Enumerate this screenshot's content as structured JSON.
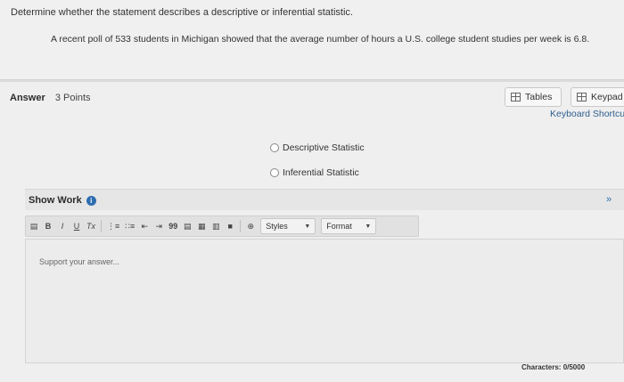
{
  "question": {
    "instruction": "Determine whether the statement describes a descriptive or inferential statistic.",
    "statement": "A recent poll of 533 students in Michigan showed that the average number of hours a U.S. college student studies per week is 6.8."
  },
  "answer": {
    "label": "Answer",
    "points": "3 Points",
    "tables_label": "Tables",
    "keypad_label": "Keypad",
    "shortcuts_label": "Keyboard Shortcu",
    "options": [
      "Descriptive Statistic",
      "Inferential Statistic"
    ]
  },
  "show_work": {
    "title": "Show Work",
    "info_icon": "i",
    "collapse_icon": "»",
    "toolbar": {
      "bold": "B",
      "italic": "I",
      "underline": "U",
      "clear": "Tx",
      "quote": "99",
      "styles": "Styles",
      "format": "Format"
    },
    "placeholder": "Support your answer...",
    "characters": "Characters: 0/5000"
  }
}
